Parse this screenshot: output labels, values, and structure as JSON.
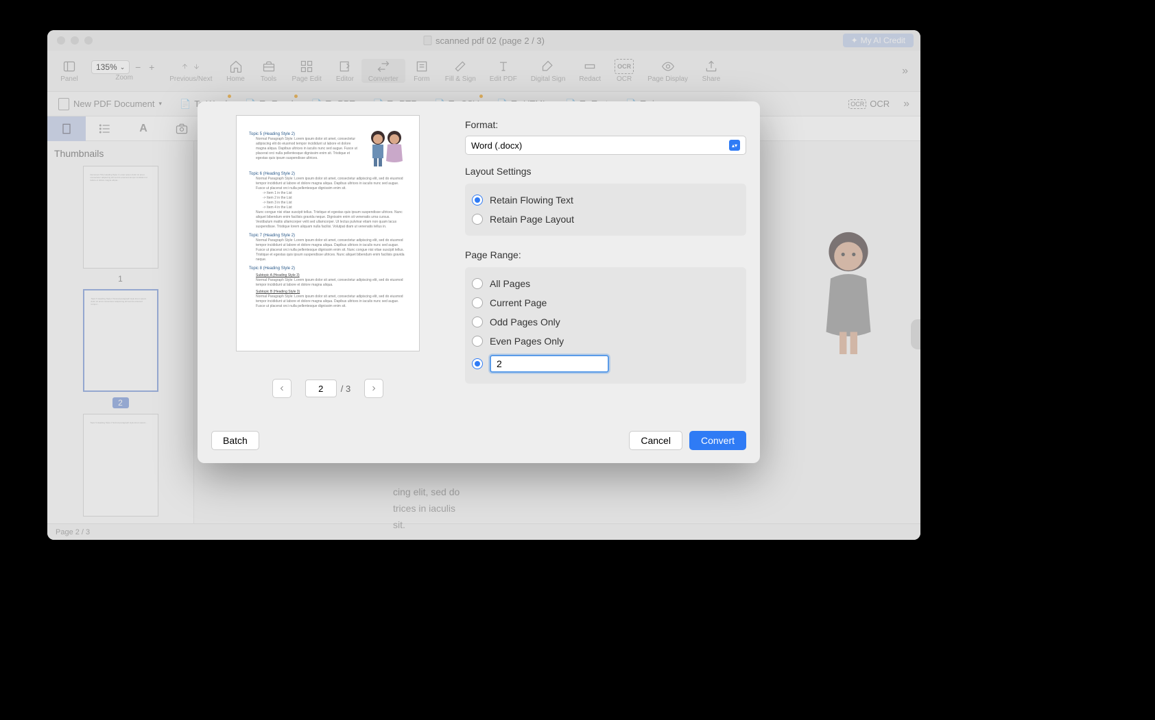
{
  "window": {
    "title": "scanned pdf 02 (page 2 / 3)",
    "ai_credit": "My AI Credit"
  },
  "toolbar": {
    "panel": "Panel",
    "zoom_value": "135%",
    "zoom": "Zoom",
    "prevnext": "Previous/Next",
    "home": "Home",
    "tools": "Tools",
    "pageedit": "Page Edit",
    "editor": "Editor",
    "converter": "Converter",
    "form": "Form",
    "fillsign": "Fill & Sign",
    "editpdf": "Edit PDF",
    "digitalsign": "Digital Sign",
    "redact": "Redact",
    "ocr": "OCR",
    "pagedisplay": "Page Display",
    "share": "Share"
  },
  "secondary": {
    "new_pdf": "New PDF Document",
    "to_word": "To Word",
    "to_excel": "To Excel",
    "to_ppt": "To PPT",
    "to_rtf": "To RTF",
    "to_csv": "To CSV",
    "to_html": "To HTML",
    "to_text": "To Text",
    "to_image": "To image",
    "ocr": "OCR"
  },
  "sidebar": {
    "title": "Thumbnails",
    "page1_num": "1",
    "page2_num": "2"
  },
  "content": {
    "paragraph_tail": "cing elit, sed do",
    "line2_tail": "trices in iaculis",
    "line3_tail": "sit.",
    "item2": "-> Item 2 in the List",
    "item3": "-> Item 3 in the List",
    "item4": "-> Item 4 in the List"
  },
  "statusbar": {
    "page": "Page 2 / 3"
  },
  "modal": {
    "format_label": "Format:",
    "format_value": "Word (.docx)",
    "layout_title": "Layout Settings",
    "layout_flowing": "Retain Flowing Text",
    "layout_page": "Retain Page Layout",
    "range_title": "Page Range:",
    "range_all": "All Pages",
    "range_current": "Current Page",
    "range_odd": "Odd Pages Only",
    "range_even": "Even Pages Only",
    "range_custom_value": "2",
    "preview_current": "2",
    "preview_total": "/ 3",
    "batch": "Batch",
    "cancel": "Cancel",
    "convert": "Convert",
    "preview": {
      "topic5": "Topic 5 (Heading Style 2)",
      "topic5_body": "Normal Paragraph Style: Lorem ipsum dolor sit amet, consectetur adipiscing elit do eiusmod tempor incididunt ut labore et dolore magna aliqua. Dapibus ultrices in iaculis nunc sed augue. Fusce ut placerat orci nulla pellentesque dignissim enim sit. Tristique et egestas quis ipsum suspendisse ultrices.",
      "topic6": "Topic 6 (Heading Style 2)",
      "topic6_body": "Normal Paragraph Style: Lorem ipsum dolor sit amet, consectetur adipiscing elit, sed do eiusmod tempor incididunt ut labore et dolore magna aliqua. Dapibus ultrices in iaculis nunc sed augue. Fusce ut placerat orci nulla pellentesque dignissim enim sit.",
      "list1": "-> Item 1 in the List",
      "list2": "-> Item 2 in the List",
      "list3": "-> Item 3 in the List",
      "list4": "-> Item 4 in the List",
      "topic6_body2": "Nunc congue nisi vitae suscipit tellus. Tristique et egestas quis ipsum suspendisse ultrices. Nunc aliquet bibendum enim facilisis gravida neque. Dignissim enim sit venenatis urna cursus. Vestibulum mattis ullamcorper velit sed ullamcorper. Ut lectus pulvinar etiam non quam lacus suspendisse. Tristique lorem aliquam nulla facilisi. Volutpat diam ut venenatis tellus in.",
      "topic7": "Topic 7 (Heading Style 2)",
      "topic7_body": "Normal Paragraph Style: Lorem ipsum dolor sit amet, consectetur adipiscing elit, sed do eiusmod tempor incididunt ut labore et dolore magna aliqua. Dapibus ultrices in iaculis nunc sed augue. Fusce ut placerat orci nulla pellentesque dignissim enim sit. Nunc congue nisi vitae suscipit tellus. Tristique et egestas quis ipsum suspendisse ultrices. Nunc aliquet bibendum enim facilisis gravida neque.",
      "topic8": "Topic 8 (Heading Style 2)",
      "subtopicA": "Subtopic A (Heading Style 3)",
      "subtopicA_body": "Normal Paragraph Style: Lorem ipsum dolor sit amet, consectetur adipiscing elit, sed do eiusmod tempor incididunt ut labore et dolore magna aliqua.",
      "subtopicB": "Subtopic B (Heading Style 3)",
      "subtopicB_body": "Normal Paragraph Style: Lorem ipsum dolor sit amet, consectetur adipiscing elit, sed do eiusmod tempor incididunt ut labore et dolore magna aliqua. Dapibus ultrices in iaculis nunc sed augue. Fusce ut placerat orci nulla pellentesque dignissim enim sit."
    }
  }
}
